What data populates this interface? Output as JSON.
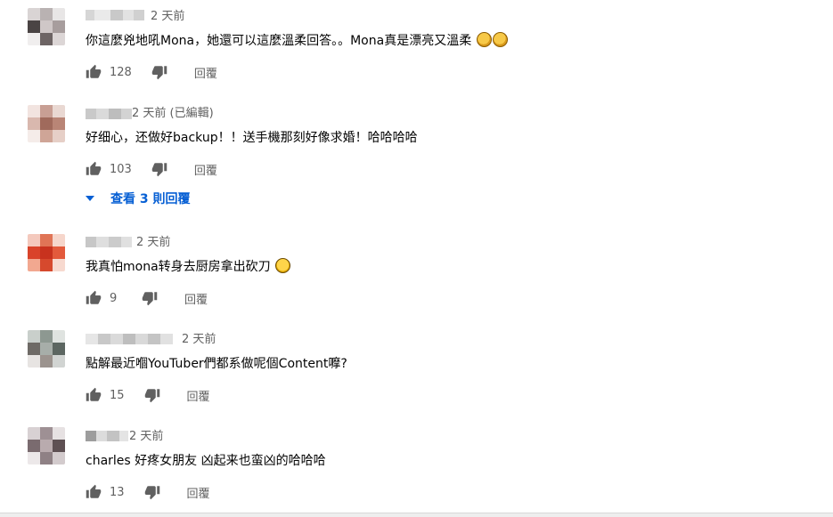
{
  "comments": [
    {
      "time": "2 天前",
      "text": "你這麼兇地吼Mona，她還可以這麼溫柔回答。。Mona真是漂亮又溫柔",
      "emoji": [
        "clapping-hands",
        "clapping-hands"
      ],
      "likes": "128",
      "reply_label": "回覆"
    },
    {
      "time": "2 天前 (已編輯)",
      "text": "好细心，还做好backup！！送手機那刻好像求婚！哈哈哈哈",
      "likes": "103",
      "reply_label": "回覆",
      "view_replies": "查看 3 則回覆"
    },
    {
      "time": "2 天前",
      "text": "我真怕mona转身去厨房拿出砍刀",
      "emoji": [
        "rolling-laughing-face"
      ],
      "likes": "9",
      "reply_label": "回覆"
    },
    {
      "time": "2 天前",
      "text": "點解最近嗰YouTuber們都系做呢個Content嚤?",
      "likes": "15",
      "reply_label": "回覆"
    },
    {
      "time": "2 天前",
      "text": "charles 好疼女朋友 凶起来也蛮凶的哈哈哈",
      "likes": "13",
      "reply_label": "回覆"
    }
  ],
  "colors": {
    "text": "#030303",
    "secondary": "#606060",
    "link": "#065fd4"
  }
}
